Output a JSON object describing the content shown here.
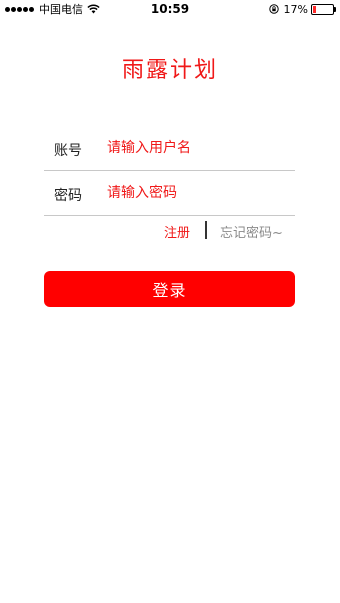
{
  "status_bar": {
    "carrier": "中国电信",
    "time": "10:59",
    "battery_percent_label": "17%",
    "battery_level": 0.17,
    "battery_color": "#ff2a2a",
    "icons": [
      "signal-dots-icon",
      "wifi-icon",
      "orientation-lock-icon",
      "battery-icon"
    ]
  },
  "app": {
    "title": "雨露计划"
  },
  "form": {
    "account": {
      "label": "账号",
      "placeholder": "请输入用户名",
      "value": ""
    },
    "password": {
      "label": "密码",
      "placeholder": "请输入密码",
      "value": ""
    }
  },
  "links": {
    "register": "注册",
    "forgot_password": "忘记密码~"
  },
  "actions": {
    "login_label": "登录"
  },
  "colors": {
    "accent": "#f01818",
    "button": "#ff0000",
    "muted_link": "#8a8a8a",
    "divider": "#c8c8c8"
  }
}
